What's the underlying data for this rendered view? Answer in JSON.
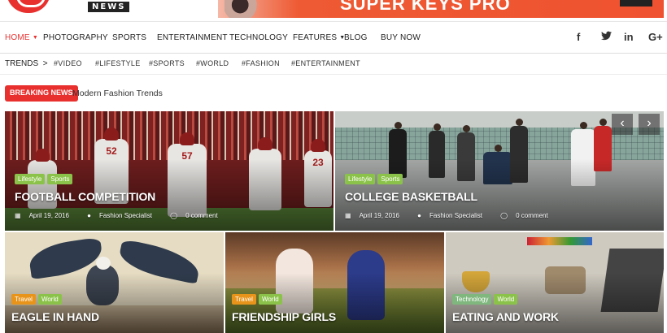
{
  "header": {
    "logo_word": "NEWS",
    "ad_text": "SUPER KEYS PRO"
  },
  "nav": {
    "items": [
      {
        "label": "HOME",
        "active": true,
        "dropdown": true
      },
      {
        "label": "PHOTOGRAPHY"
      },
      {
        "label": "SPORTS"
      },
      {
        "label": "ENTERTAINMENT"
      },
      {
        "label": "TECHNOLOGY"
      },
      {
        "label": "FEATURES",
        "dropdown": true
      },
      {
        "label": "BLOG"
      },
      {
        "label": "BUY NOW"
      }
    ],
    "social": [
      {
        "icon": "facebook-icon",
        "glyph": "f"
      },
      {
        "icon": "twitter-icon",
        "glyph": "🐦"
      },
      {
        "icon": "linkedin-icon",
        "glyph": "in"
      },
      {
        "icon": "googleplus-icon",
        "glyph": "G+"
      }
    ]
  },
  "trends": {
    "label": "TRENDS",
    "arrow": ">",
    "tags": [
      "#VIDEO",
      "#LIFESTYLE",
      "#SPORTS",
      "#WORLD",
      "#FASHION",
      "#ENTERTAINMENT"
    ]
  },
  "breaking": {
    "label": "BREAKING NEWS",
    "headline": "Modern Fashion Trends"
  },
  "featured": [
    {
      "title": "FOOTBALL COMPETITION",
      "categories": [
        "Lifestyle",
        "Sports"
      ],
      "date": "April 19, 2016",
      "author": "Fashion Specialist",
      "comments": "0 comment"
    },
    {
      "title": "COLLEGE BASKETBALL",
      "categories": [
        "Lifestyle",
        "Sports"
      ],
      "date": "April 19, 2016",
      "author": "Fashion Specialist",
      "comments": "0 comment"
    }
  ],
  "grid": [
    {
      "title": "EAGLE IN HAND",
      "categories": [
        "Travel",
        "World"
      ]
    },
    {
      "title": "FRIENDSHIP GIRLS",
      "categories": [
        "Travel",
        "World"
      ]
    },
    {
      "title": "EATING AND WORK",
      "categories": [
        "Technology",
        "World"
      ]
    }
  ],
  "slider": {
    "prev": "‹",
    "next": "›"
  },
  "colors": {
    "accent": "#e8312f",
    "green_badge": "#8bc34a",
    "orange_badge": "#e8941a"
  }
}
